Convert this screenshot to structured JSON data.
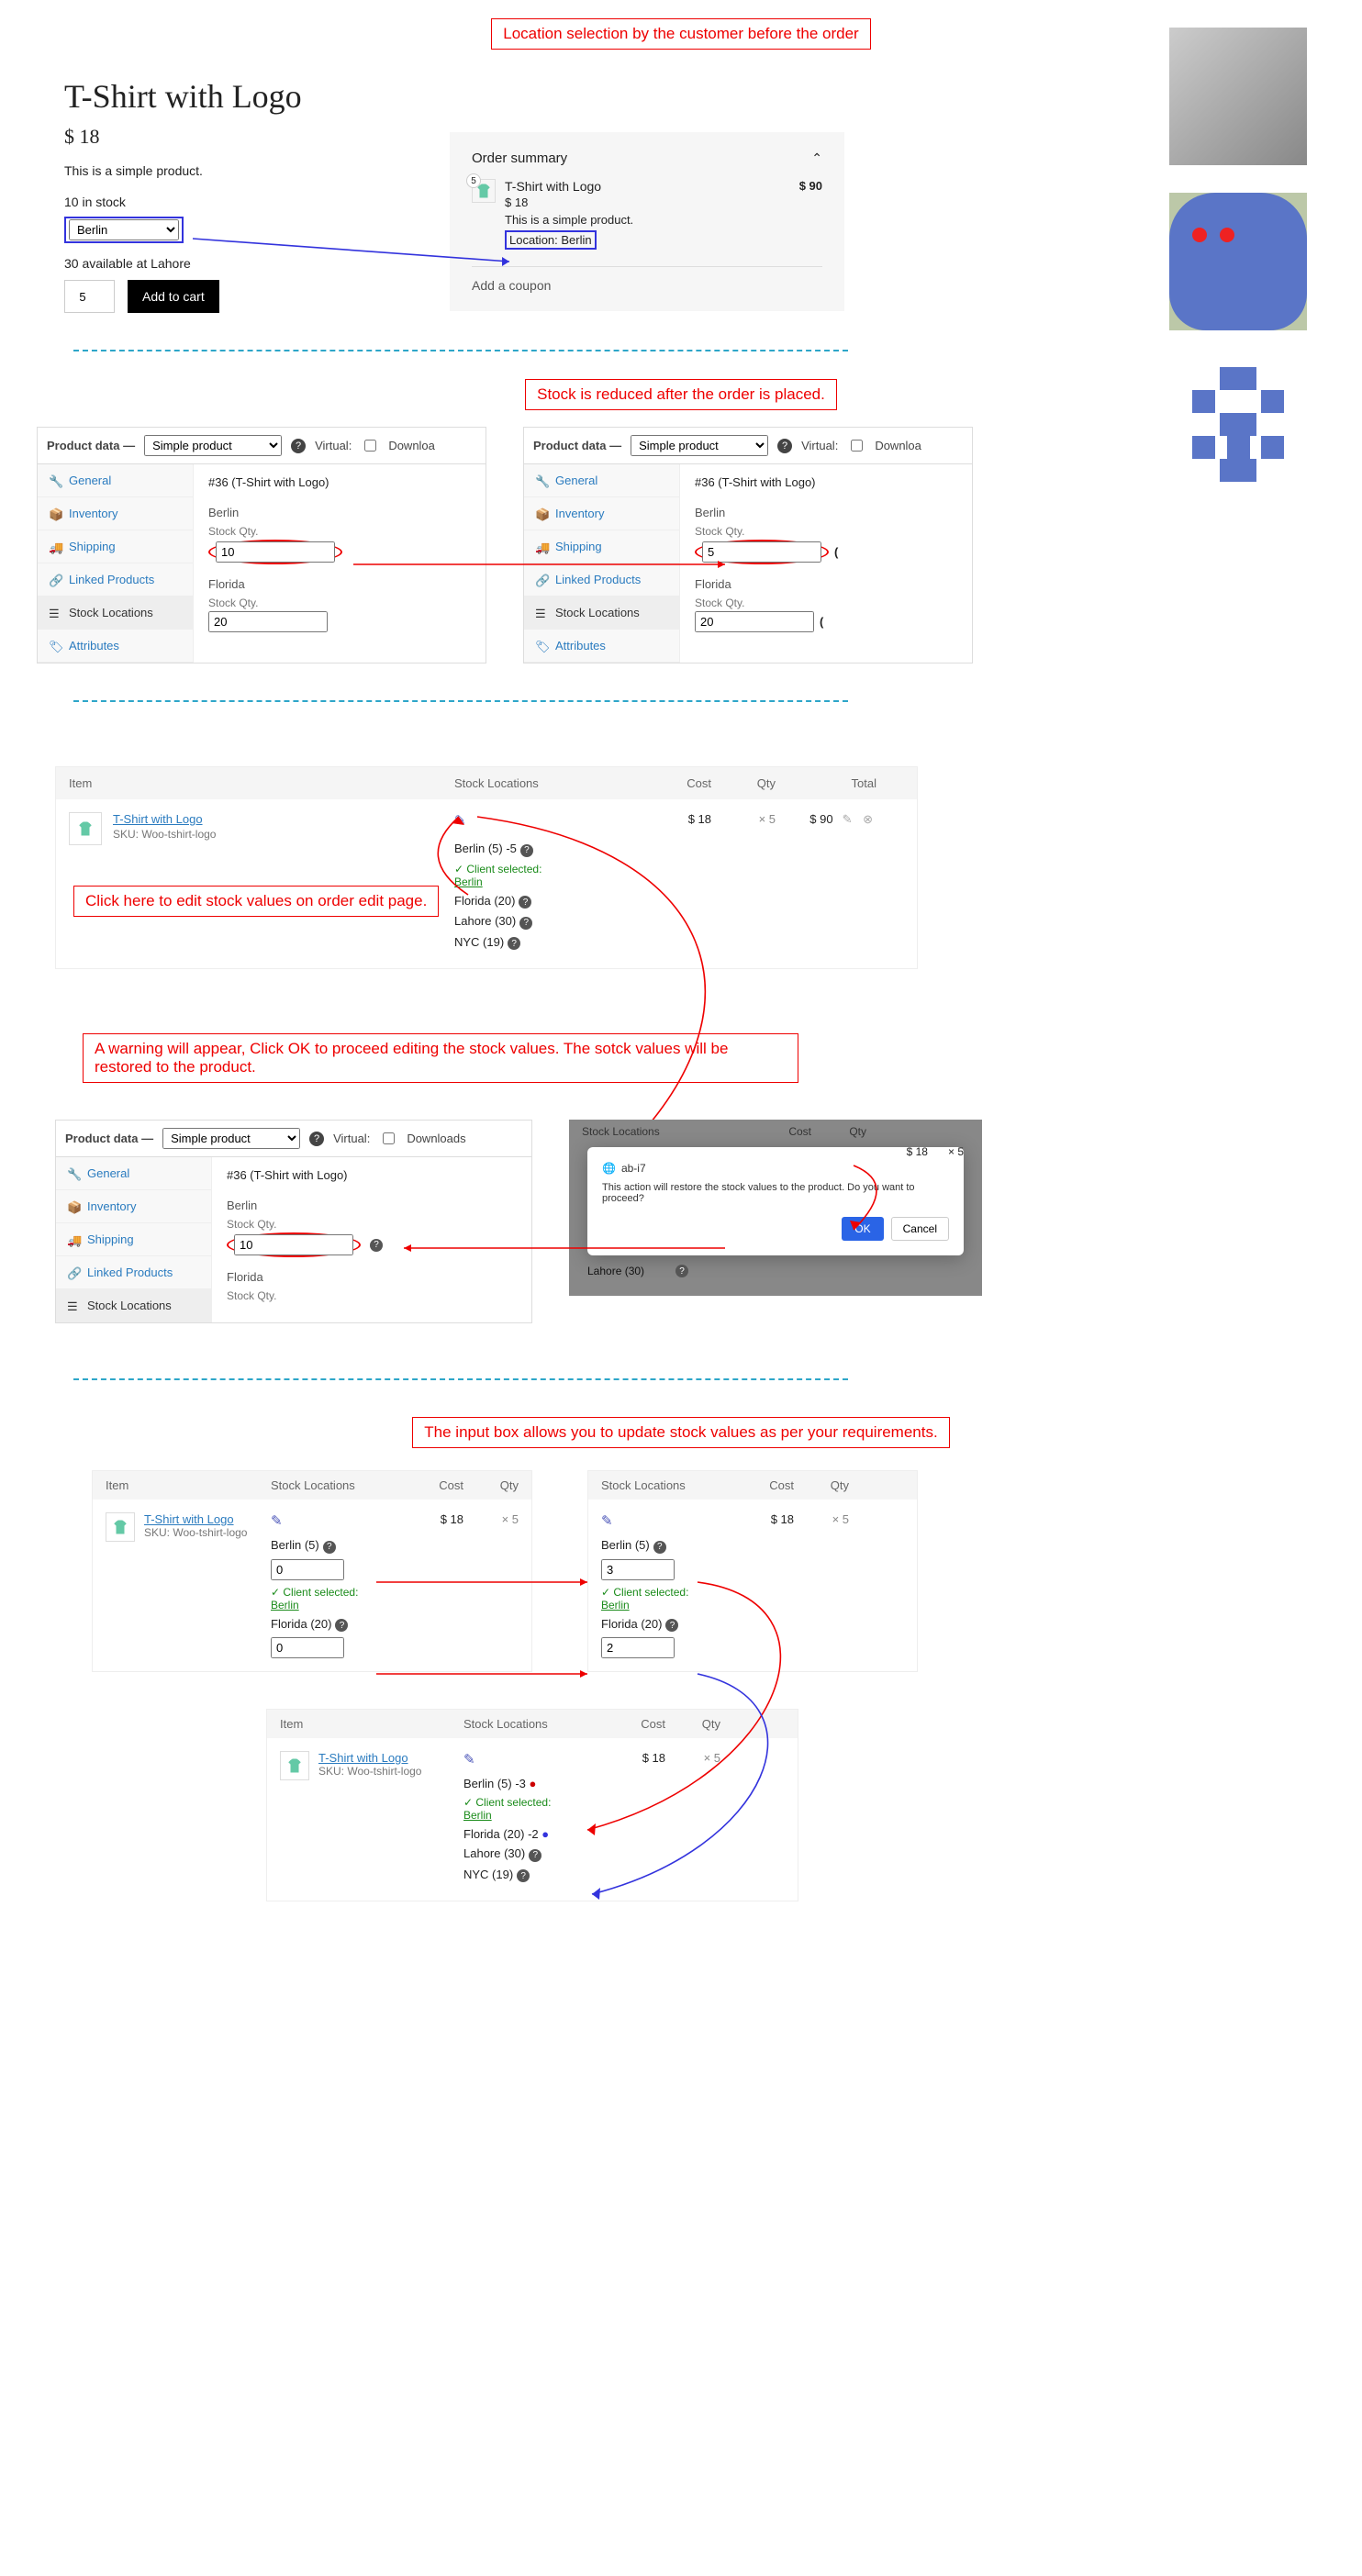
{
  "annotations": {
    "a1": "Location selection by the customer before the order",
    "a2": "Stock is reduced after the order is placed.",
    "a3": "Click here to edit stock values on order edit page.",
    "a4": "A warning will appear, Click OK to proceed editing the stock values. The sotck values will be restored to the product.",
    "a5": "The input box allows you to update stock values as per your requirements."
  },
  "front": {
    "title": "T-Shirt with Logo",
    "price": "$ 18",
    "desc": "This is a simple product.",
    "stock_line": "10 in stock",
    "location_options": [
      "Berlin"
    ],
    "location_value": "Berlin",
    "available_line": "30 available at Lahore",
    "qty": "5",
    "add_btn": "Add to cart"
  },
  "order_summary": {
    "heading": "Order summary",
    "qty": "5",
    "name": "T-Shirt with Logo",
    "total": "$ 90",
    "unit": "$ 18",
    "desc": "This is a simple product.",
    "location": "Location: Berlin",
    "coupon": "Add a coupon"
  },
  "woo": {
    "pd_label": "Product data —",
    "simple": "Simple product",
    "virtual": "Virtual:",
    "download": "Downloa",
    "download_full": "Downloads",
    "item_title": "#36 (T-Shirt with Logo)",
    "tabs": {
      "general": "General",
      "inventory": "Inventory",
      "shipping": "Shipping",
      "linked": "Linked Products",
      "stockloc": "Stock Locations",
      "attributes": "Attributes"
    },
    "berlin": "Berlin",
    "florida": "Florida",
    "stockqty": "Stock Qty.",
    "before_berlin": "10",
    "before_florida": "20",
    "after_berlin": "5",
    "after_florida": "20",
    "restored_berlin": "10"
  },
  "order_edit": {
    "cols": {
      "item": "Item",
      "sl": "Stock Locations",
      "cost": "Cost",
      "qty": "Qty",
      "total": "Total"
    },
    "product": "T-Shirt with Logo",
    "sku": "SKU: Woo-tshirt-logo",
    "cost": "$ 18",
    "qty": "× 5",
    "total": "$ 90",
    "berlin_delta": "Berlin (5) -5",
    "client_sel": "✓ Client selected:",
    "client_sel_loc": "Berlin",
    "florida": "Florida (20)",
    "lahore": "Lahore (30)",
    "nyc": "NYC (19)"
  },
  "modal": {
    "host": "ab-i7",
    "text": "This action will restore the stock values to the product. Do you want to proceed?",
    "ok": "OK",
    "cancel": "Cancel"
  },
  "edit_inputs": {
    "left": {
      "berlin_lbl": "Berlin (5)",
      "berlin_val": "0",
      "florida_lbl": "Florida (20)",
      "florida_val": "0"
    },
    "right": {
      "berlin_lbl": "Berlin (5)",
      "berlin_val": "3",
      "florida_lbl": "Florida (20)",
      "florida_val": "2"
    },
    "final": {
      "berlin": "Berlin (5) -3",
      "florida": "Florida (20) -2",
      "lahore": "Lahore (30)",
      "nyc": "NYC (19)"
    }
  }
}
